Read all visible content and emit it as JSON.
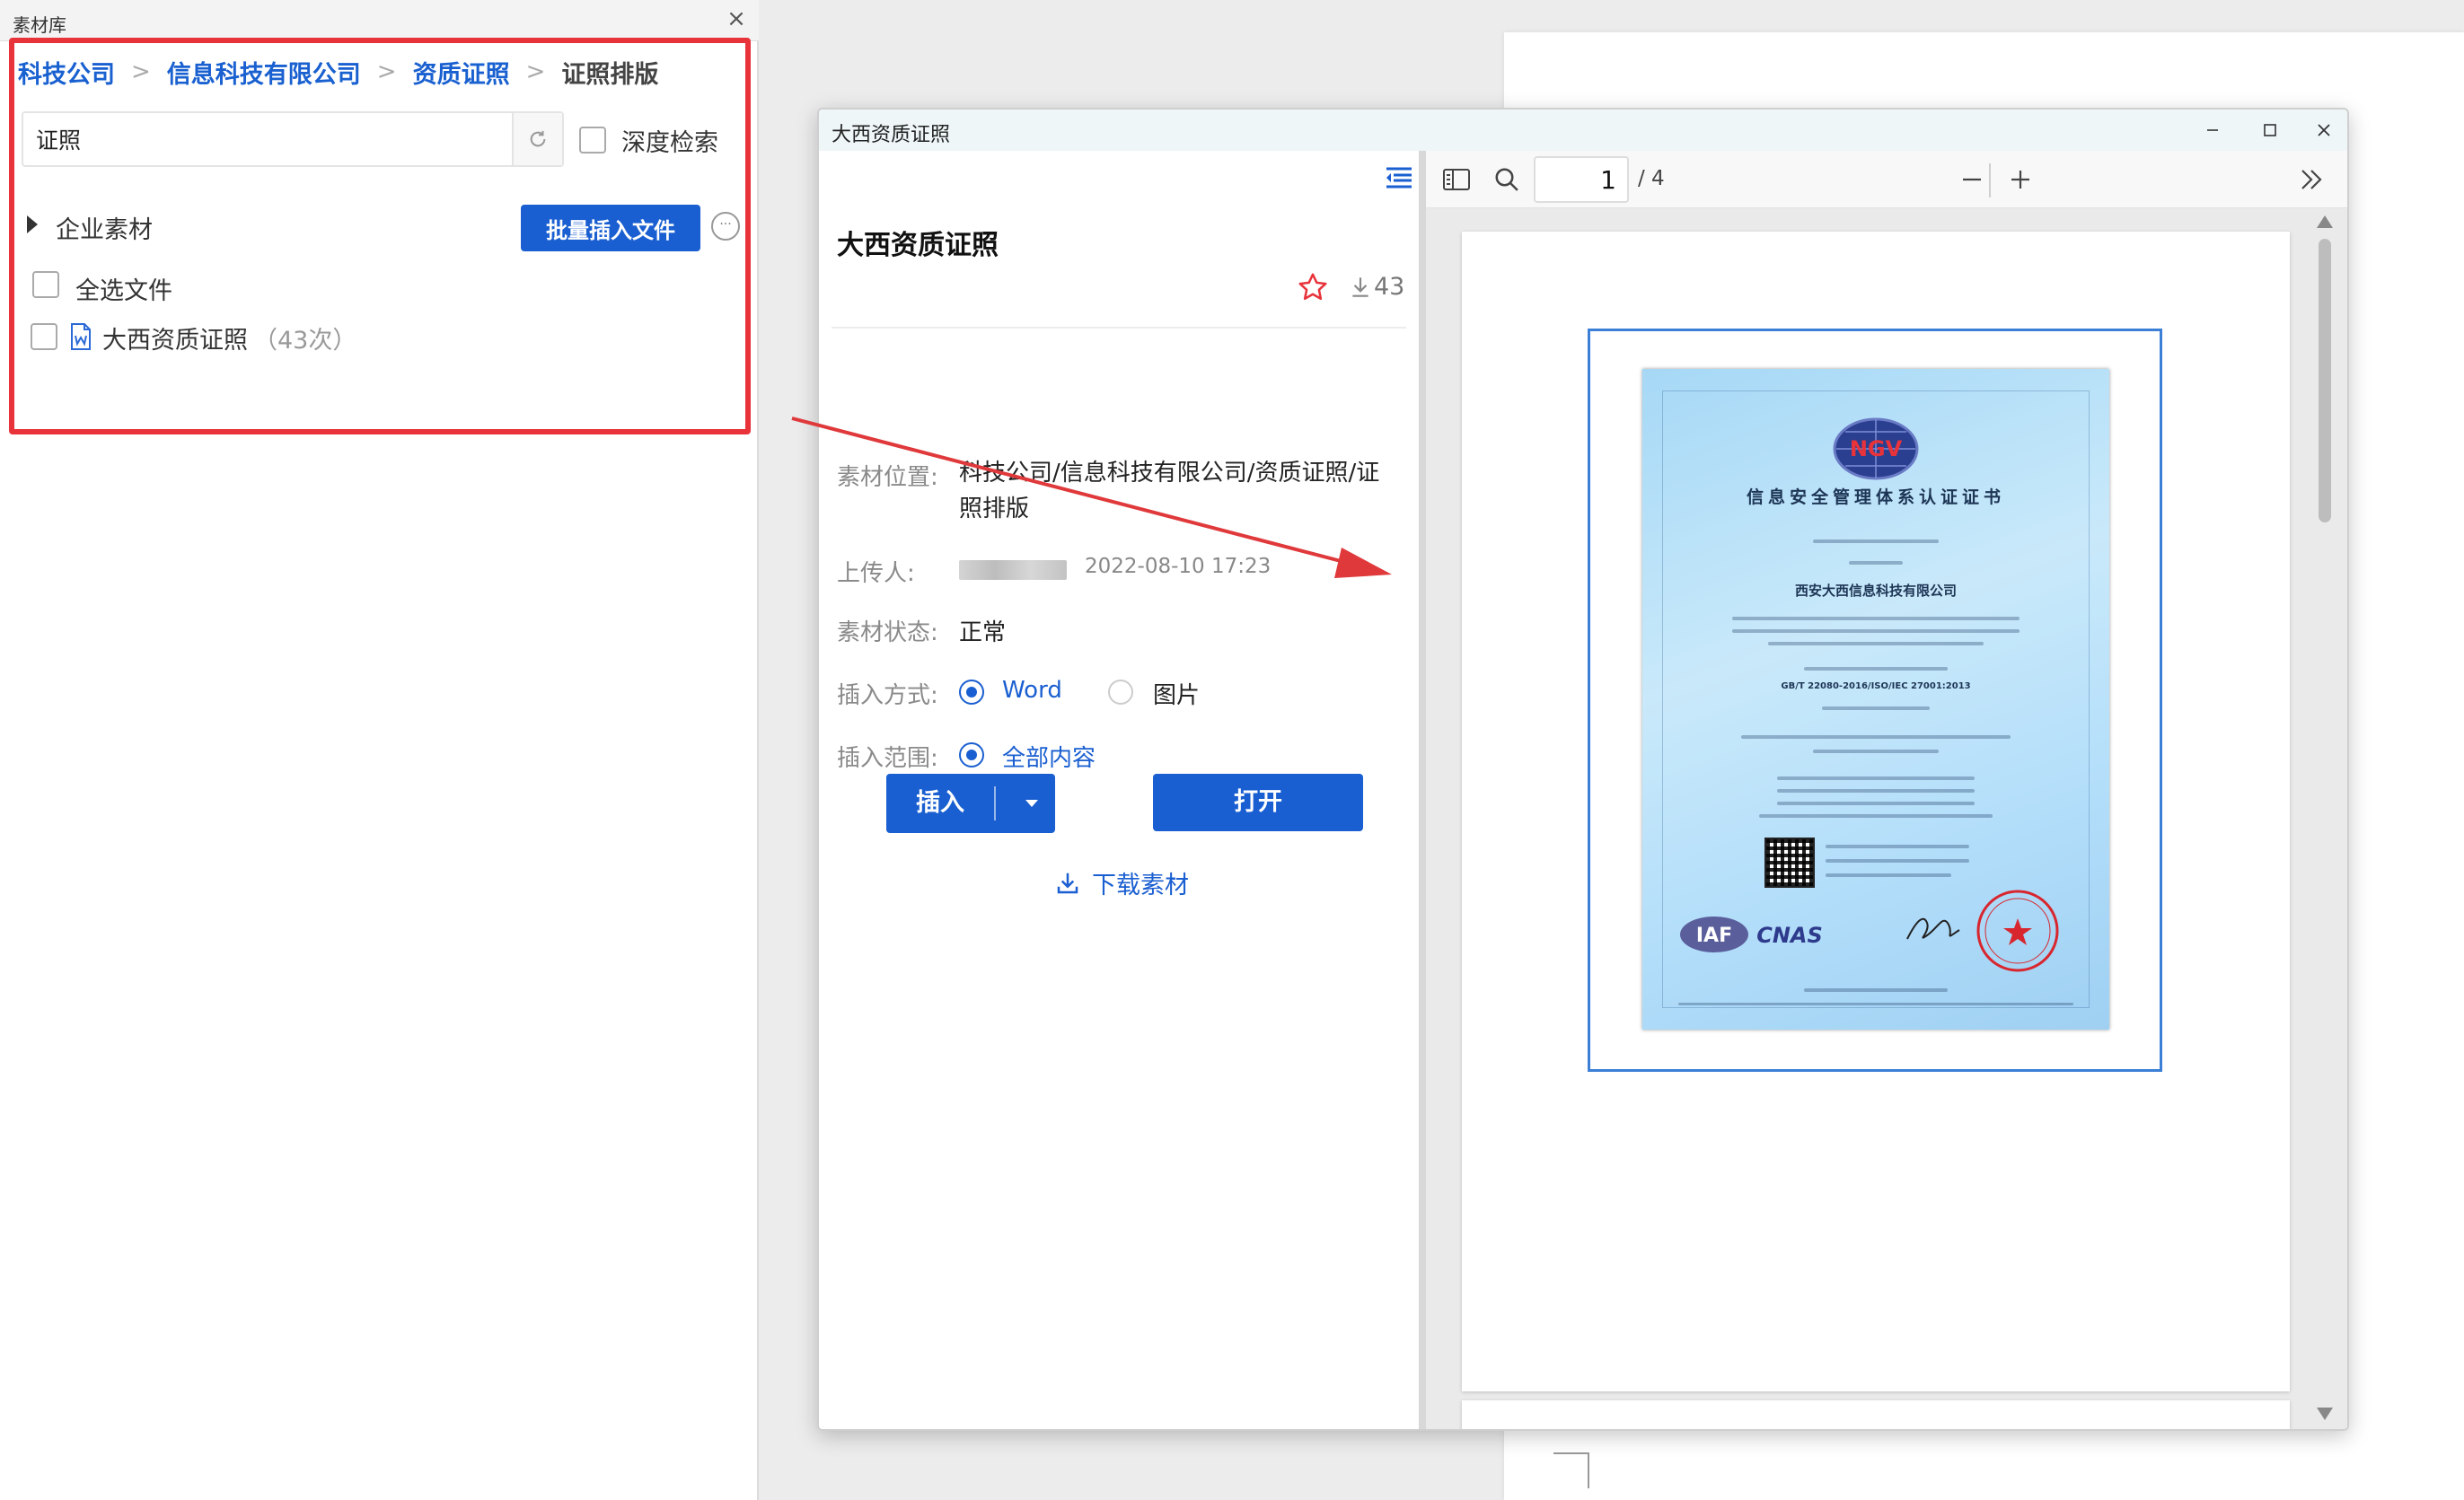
{
  "left_panel": {
    "title": "素材库",
    "breadcrumb": [
      "科技公司",
      "信息科技有限公司",
      "资质证照",
      "证照排版"
    ],
    "search": {
      "value": "证照"
    },
    "deep_search_label": "深度检索",
    "tree_label": "企业素材",
    "batch_insert_label": "批量插入文件",
    "more_label": "···",
    "select_all_label": "全选文件",
    "file": {
      "name": "大西资质证照",
      "count": "（43次）"
    }
  },
  "dialog": {
    "title": "大西资质证照",
    "info": {
      "title": "大西资质证照",
      "download_count": "43",
      "location_label": "素材位置:",
      "location_value": "科技公司/信息科技有限公司/资质证照/证照排版",
      "uploader_label": "上传人:",
      "upload_time": "2022-08-10 17:23",
      "status_label": "素材状态:",
      "status_value": "正常",
      "insert_mode_label": "插入方式:",
      "insert_mode_options": [
        "Word",
        "图片"
      ],
      "insert_mode_selected": "Word",
      "insert_range_label": "插入范围:",
      "insert_range_value": "全部内容",
      "insert_button": "插入",
      "open_button": "打开",
      "download_link": "下载素材"
    },
    "viewer": {
      "page": "1",
      "total_pages": "/ 4",
      "certificate": {
        "logo": "NGV",
        "title": "信息安全管理体系认证证书",
        "company": "西安大西信息科技有限公司",
        "standard": "GB/T 22080-2016/ISO/IEC 27001:2013",
        "badges": [
          "IAF",
          "CNAS"
        ]
      }
    }
  },
  "colors": {
    "accent": "#1a5fd1",
    "highlight": "#e8333a",
    "arrow": "#e0393b"
  }
}
